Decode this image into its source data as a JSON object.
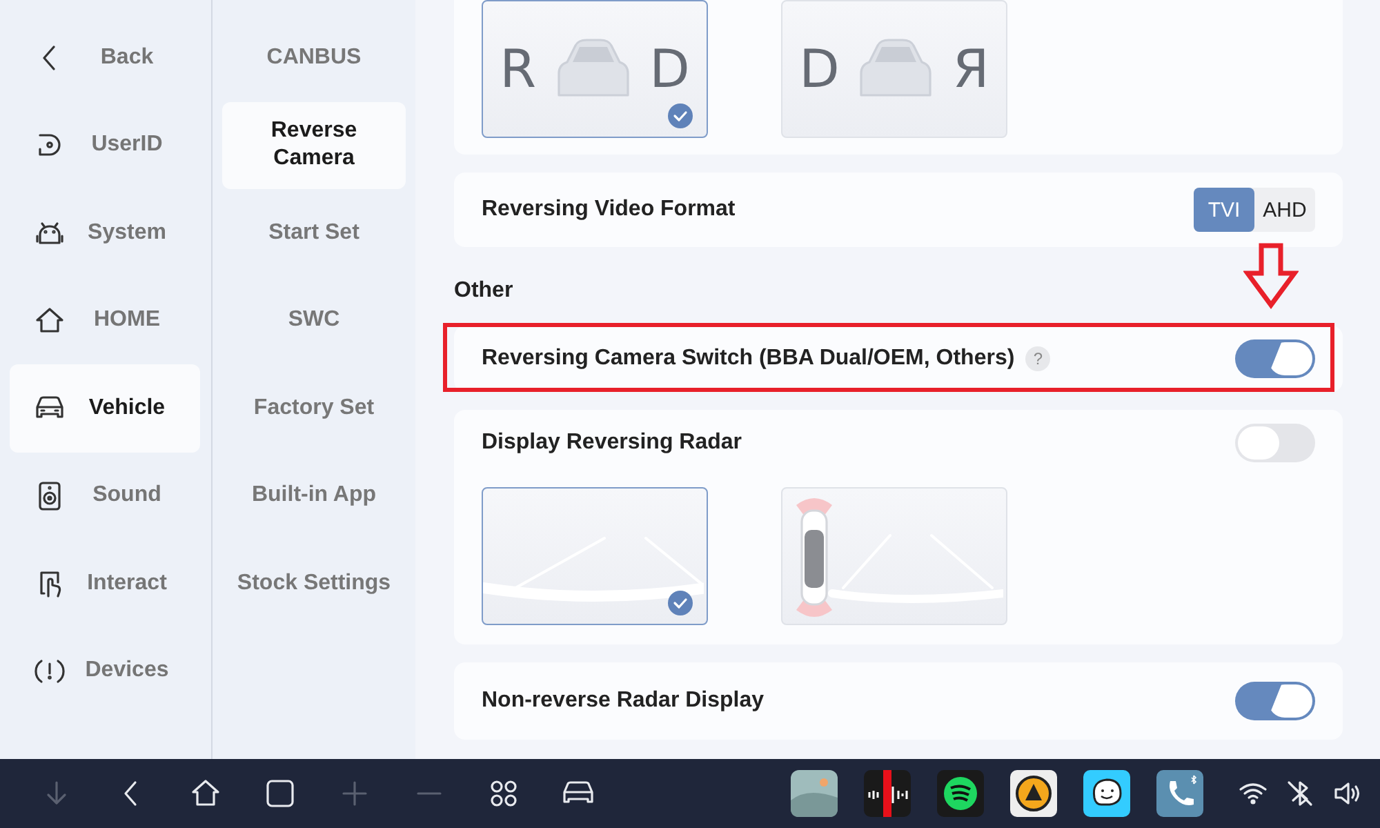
{
  "main_nav": [
    {
      "label": "Back",
      "selected": false
    },
    {
      "label": "UserID",
      "selected": false
    },
    {
      "label": "System",
      "selected": false
    },
    {
      "label": "HOME",
      "selected": false
    },
    {
      "label": "Vehicle",
      "selected": true
    },
    {
      "label": "Sound",
      "selected": false
    },
    {
      "label": "Interact",
      "selected": false
    },
    {
      "label": "Devices",
      "selected": false
    }
  ],
  "sub_nav": [
    {
      "label": "CANBUS",
      "selected": false
    },
    {
      "label": "Reverse Camera",
      "selected": true
    },
    {
      "label": "Start Set",
      "selected": false
    },
    {
      "label": "SWC",
      "selected": false
    },
    {
      "label": "Factory Set",
      "selected": false
    },
    {
      "label": "Built-in App",
      "selected": false
    },
    {
      "label": "Stock Settings",
      "selected": false
    }
  ],
  "settings": [
    {
      "kind": "image_choice",
      "options": [
        {
          "kind": "gear_view",
          "letters": [
            "R",
            "D"
          ],
          "selected": true
        },
        {
          "kind": "gear_view",
          "letters": [
            "D",
            "Я"
          ],
          "selected": false
        }
      ]
    },
    {
      "kind": "segmented",
      "label": "Reversing Video Format",
      "options": [
        {
          "label": "TVI",
          "selected": true
        },
        {
          "label": "AHD",
          "selected": false
        }
      ]
    },
    {
      "kind": "heading",
      "label": "Other"
    },
    {
      "kind": "switch",
      "label": "Reversing Camera Switch (BBA Dual/OEM, Others)",
      "help": "?",
      "on": true,
      "highlighted": true
    },
    {
      "kind": "switch",
      "label": "Display Reversing Radar",
      "on": false,
      "highlighted": false,
      "options": [
        {
          "kind": "guide_lines",
          "selected": true
        },
        {
          "kind": "radar_car",
          "selected": false
        }
      ]
    },
    {
      "kind": "switch",
      "label": "Non-reverse Radar Display",
      "on": true,
      "highlighted": false
    }
  ],
  "nav_bar": [
    {
      "disabled": true
    },
    {
      "disabled": false
    },
    {
      "disabled": false
    },
    {
      "disabled": false
    },
    {
      "disabled": true
    },
    {
      "disabled": true
    },
    {
      "disabled": false
    },
    {
      "disabled": false
    }
  ],
  "dock_apps": [
    {
      "kind": "gallery"
    },
    {
      "kind": "radio"
    },
    {
      "kind": "music"
    },
    {
      "kind": "navigator"
    },
    {
      "kind": "waze"
    },
    {
      "kind": "phone"
    }
  ],
  "status_icons": [
    {
      "kind": "wifi"
    },
    {
      "kind": "bluetooth"
    },
    {
      "kind": "volume"
    }
  ]
}
